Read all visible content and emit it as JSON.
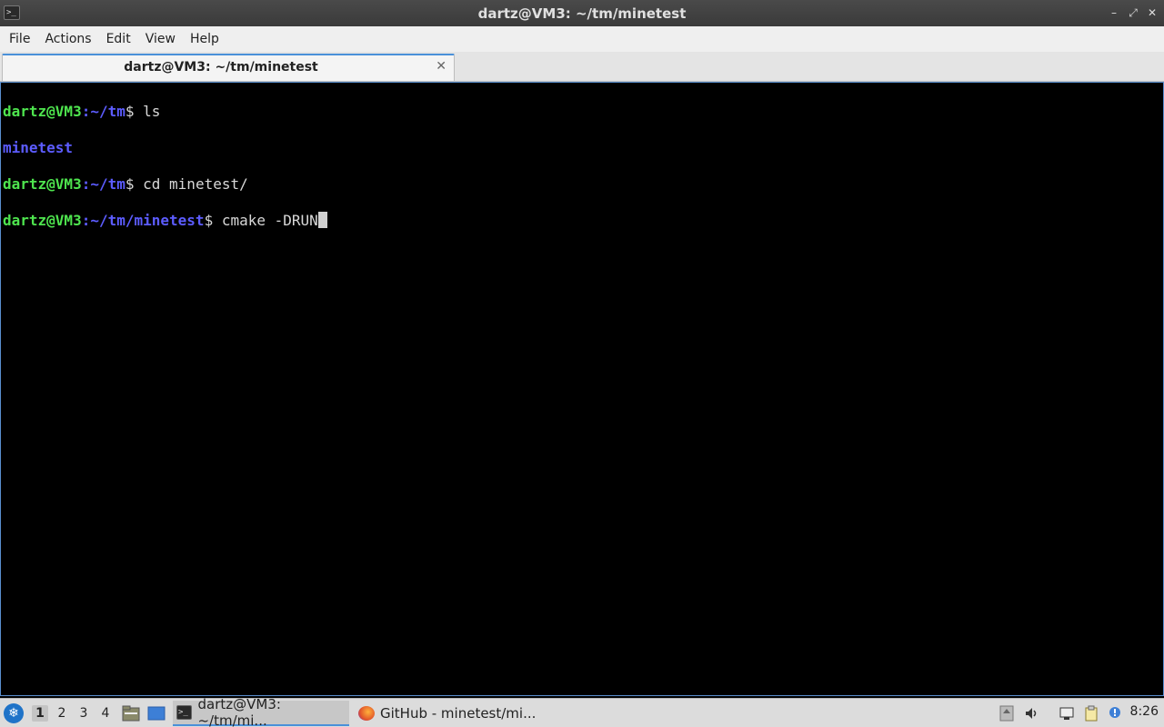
{
  "window": {
    "title": "dartz@VM3: ~/tm/minetest",
    "app_icon_glyph": ">_"
  },
  "menu": [
    "File",
    "Actions",
    "Edit",
    "View",
    "Help"
  ],
  "tab": {
    "label": "dartz@VM3: ~/tm/minetest",
    "close_glyph": "✕"
  },
  "terminal": {
    "lines": [
      {
        "user": "dartz@VM3",
        "path": ":~/tm",
        "cmd": "$ ls"
      },
      {
        "output": "minetest"
      },
      {
        "user": "dartz@VM3",
        "path": ":~/tm",
        "cmd": "$ cd minetest/"
      },
      {
        "user": "dartz@VM3",
        "path": ":~/tm/minetest",
        "cmd": "$ cmake -DRUN"
      }
    ],
    "colors": {
      "user": "#4ee44e",
      "path": "#5c5cff",
      "background": "#000000"
    }
  },
  "taskbar": {
    "desktops": [
      "1",
      "2",
      "3",
      "4"
    ],
    "active_desktop": "1",
    "tasks": [
      {
        "label": "dartz@VM3: ~/tm/mi...",
        "icon": "terminal-icon",
        "active": true
      },
      {
        "label": "GitHub - minetest/mi...",
        "icon": "firefox-icon",
        "active": false
      }
    ],
    "clock": "8:26"
  }
}
